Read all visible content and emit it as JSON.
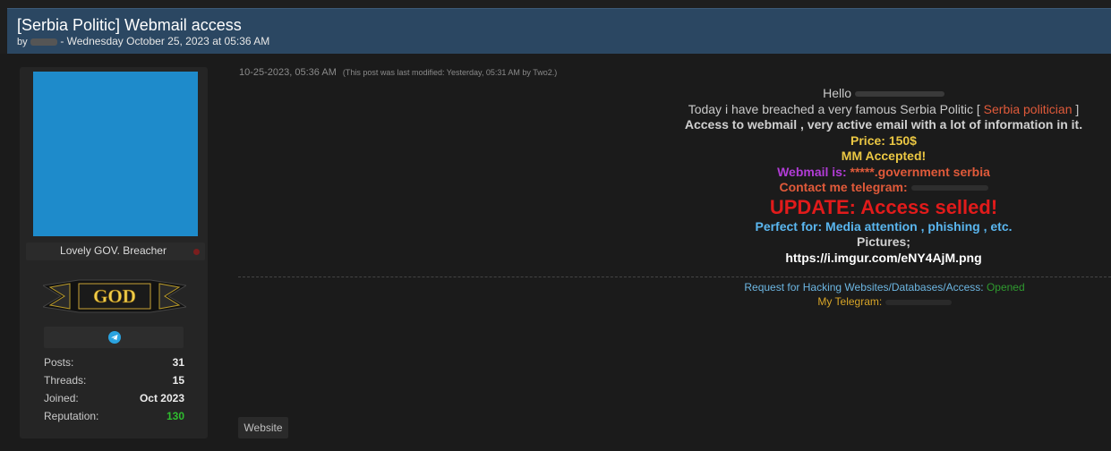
{
  "thread": {
    "title": "[Serbia Politic] Webmail access",
    "by_label": "by",
    "date": "- Wednesday October 25, 2023 at 05:36 AM"
  },
  "user": {
    "username": "Lovely GOV. Breacher",
    "rank_badge": "GOD",
    "contact_icon": "telegram-icon",
    "stats": [
      {
        "label": "Posts:",
        "value": "31"
      },
      {
        "label": "Threads:",
        "value": "15"
      },
      {
        "label": "Joined:",
        "value": "Oct 2023"
      },
      {
        "label": "Reputation:",
        "value": "130"
      }
    ]
  },
  "post": {
    "date": "10-25-2023, 05:36 AM",
    "modified_note": "(This post was last modified: Yesterday, 05:31 AM by Two2.)",
    "hello": "Hello",
    "breach_prefix": "Today i have breached a very famous Serbia Politic [",
    "breach_link": "Serbia politician",
    "breach_suffix": "]",
    "access": "Access to webmail , very active email with a lot of information in it.",
    "price": "Price: 150$",
    "mm": "MM Accepted!",
    "webmail_label": "Webmail is:",
    "webmail_value": "*****.government serbia",
    "contact": "Contact me telegram:",
    "update": "UPDATE: Access selled!",
    "perfect": "Perfect for: Media attention , phishing , etc.",
    "pictures": "Pictures;",
    "picture_link": "https://i.imgur.com/eNY4AjM.png"
  },
  "signature": {
    "request_label": "Request for Hacking Websites/Databases/Access:",
    "request_status": "Opened",
    "telegram_label": "My Telegram:"
  },
  "buttons": {
    "website": "Website"
  },
  "colors": {
    "header_bg": "#2b4762",
    "avatar": "#1e8bcb",
    "update_red": "#e11b1b",
    "reputation_green": "#2fbe2f"
  }
}
